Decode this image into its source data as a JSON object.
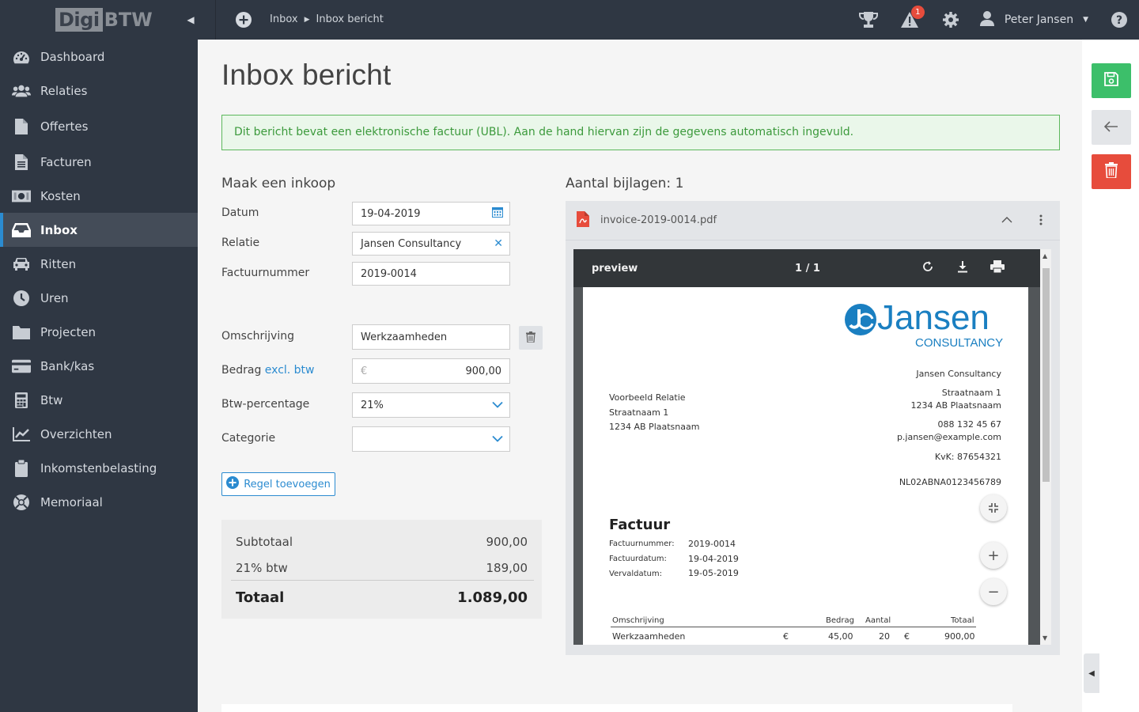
{
  "logo": {
    "part1": "Digi",
    "part2": "BTW"
  },
  "topbar": {
    "breadcrumb": [
      "Inbox",
      "Inbox bericht"
    ],
    "alert_count": "1",
    "user_name": "Peter Jansen"
  },
  "sidebar": {
    "items": [
      {
        "label": "Dashboard",
        "icon": "dashboard-icon"
      },
      {
        "label": "Relaties",
        "icon": "users-icon"
      },
      {
        "label": "Offertes",
        "icon": "file-icon"
      },
      {
        "label": "Facturen",
        "icon": "file-text-icon"
      },
      {
        "label": "Kosten",
        "icon": "money-icon"
      },
      {
        "label": "Inbox",
        "icon": "inbox-icon",
        "active": true
      },
      {
        "label": "Ritten",
        "icon": "car-icon"
      },
      {
        "label": "Uren",
        "icon": "clock-icon"
      },
      {
        "label": "Projecten",
        "icon": "folder-icon"
      },
      {
        "label": "Bank/kas",
        "icon": "credit-card-icon"
      },
      {
        "label": "Btw",
        "icon": "calculator-icon"
      },
      {
        "label": "Overzichten",
        "icon": "line-chart-icon"
      },
      {
        "label": "Inkomstenbelasting",
        "icon": "clipboard-icon"
      },
      {
        "label": "Memoriaal",
        "icon": "life-ring-icon"
      }
    ]
  },
  "page": {
    "title": "Inbox bericht",
    "alert": "Dit bericht bevat een elektronische factuur (UBL). Aan de hand hiervan zijn de gegevens automatisch ingevuld."
  },
  "form": {
    "section_title": "Maak een inkoop",
    "datum_label": "Datum",
    "datum_value": "19-04-2019",
    "relatie_label": "Relatie",
    "relatie_value": "Jansen Consultancy",
    "factuurnummer_label": "Factuurnummer",
    "factuurnummer_value": "2019-0014",
    "omschrijving_label": "Omschrijving",
    "omschrijving_value": "Werkzaamheden",
    "bedrag_label": "Bedrag",
    "bedrag_suffix": "excl. btw",
    "bedrag_currency": "€",
    "bedrag_value": "900,00",
    "btw_label": "Btw-percentage",
    "btw_value": "21%",
    "categorie_label": "Categorie",
    "categorie_value": "",
    "add_line_label": "Regel toevoegen"
  },
  "totals": {
    "subtotaal_label": "Subtotaal",
    "subtotaal_value": "900,00",
    "btw_label": "21% btw",
    "btw_value": "189,00",
    "totaal_label": "Totaal",
    "totaal_value": "1.089,00"
  },
  "attachments": {
    "title": "Aantal bijlagen: 1",
    "filename": "invoice-2019-0014.pdf",
    "viewer_title": "preview",
    "page_indicator": "1 / 1"
  },
  "invoice": {
    "logo_name": "Jansen",
    "logo_sub": "CONSULTANCY",
    "sender_name": "Jansen Consultancy",
    "sender_street": "Straatnaam 1",
    "sender_city": "1234 AB Plaatsnaam",
    "sender_phone": "088 132 45 67",
    "sender_email": "p.jansen@example.com",
    "sender_kvk": "KvK: 87654321",
    "sender_iban": "NL02ABNA0123456789",
    "recipient_name": "Voorbeeld Relatie",
    "recipient_street": "Straatnaam 1",
    "recipient_city": "1234 AB  Plaatsnaam",
    "heading": "Factuur",
    "meta": [
      {
        "label": "Factuurnummer:",
        "value": "2019-0014"
      },
      {
        "label": "Factuurdatum:",
        "value": "19-04-2019"
      },
      {
        "label": "Vervaldatum:",
        "value": "19-05-2019"
      }
    ],
    "table_headers": {
      "omschrijving": "Omschrijving",
      "bedrag": "Bedrag",
      "aantal": "Aantal",
      "totaal": "Totaal"
    },
    "row": {
      "omschrijving": "Werkzaamheden",
      "cur1": "€",
      "bedrag": "45,00",
      "aantal": "20",
      "cur2": "€",
      "totaal": "900,00"
    }
  },
  "colors": {
    "sidebar_bg": "#2f3743",
    "accent_blue": "#2b8bd0",
    "save_green": "#3cbf6a",
    "delete_red": "#e74c3c",
    "alert_green": "#5cb85c"
  }
}
